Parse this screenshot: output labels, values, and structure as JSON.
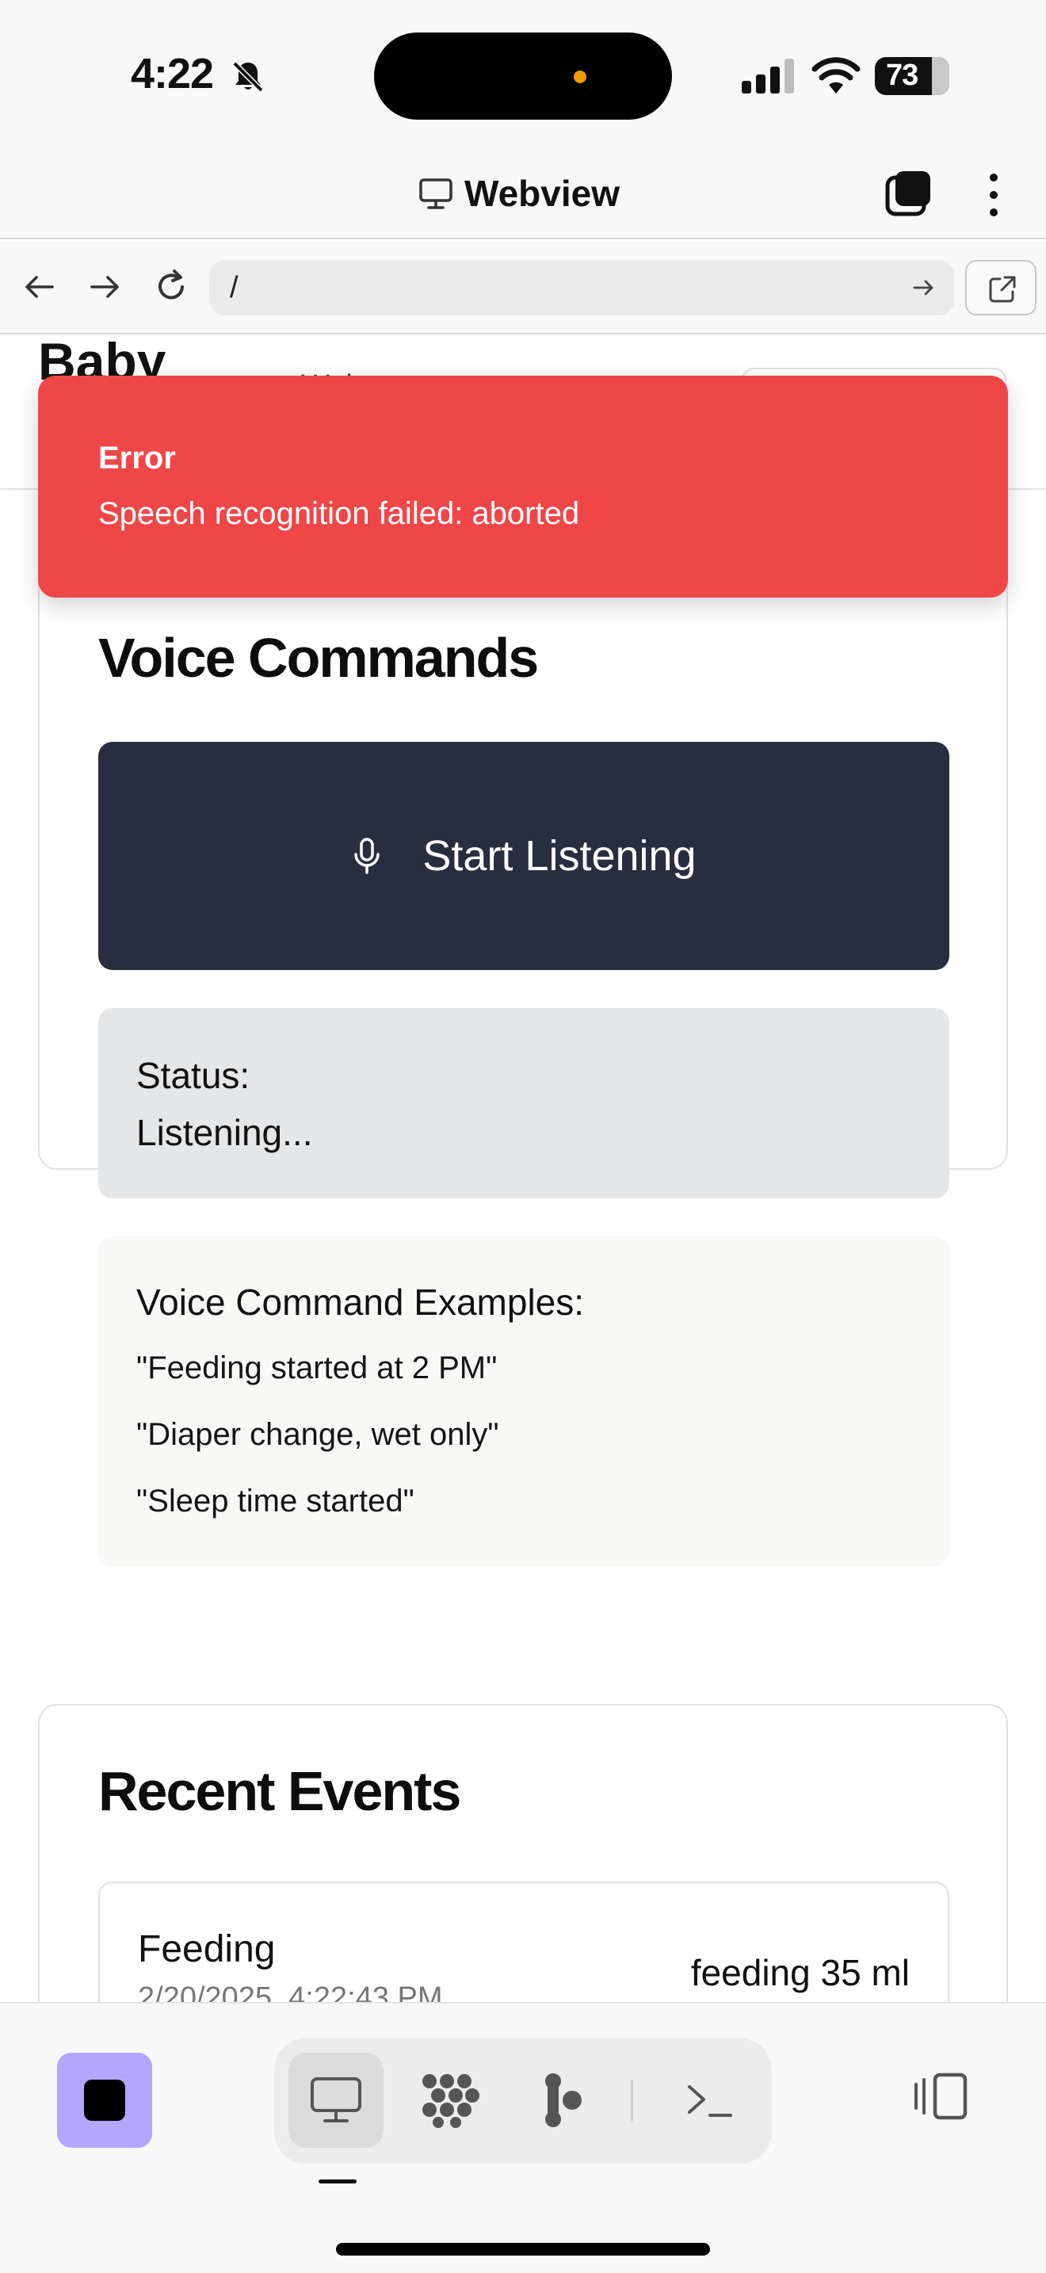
{
  "status_bar": {
    "time": "4:22",
    "battery": "73",
    "icons": [
      "bell-slash-icon",
      "signal-icon",
      "wifi-icon",
      "battery-icon"
    ]
  },
  "title_bar": {
    "title": "Webview",
    "icons": [
      "monitor-icon",
      "tabs-icon",
      "more-vertical-icon"
    ]
  },
  "browser": {
    "url": "/",
    "icons": [
      "back-arrow-icon",
      "forward-arrow-icon",
      "reload-icon",
      "go-arrow-icon",
      "external-link-icon"
    ]
  },
  "app_header": {
    "title": "Baby",
    "subtitle": "Web"
  },
  "toast": {
    "title": "Error",
    "message": "Speech recognition failed: aborted",
    "color": "#ef4648"
  },
  "voice_card": {
    "title": "Voice Commands",
    "button_label": "Start Listening",
    "button_color": "#272f3f",
    "status_label": "Status:",
    "status_value": "Listening...",
    "examples_title": "Voice Command Examples:",
    "examples": [
      "\"Feeding started at 2 PM\"",
      "\"Diaper change, wet only\"",
      "\"Sleep time started\""
    ]
  },
  "events_card": {
    "title": "Recent Events",
    "events": [
      {
        "type": "Feeding",
        "timestamp": "2/20/2025, 4:22:43 PM",
        "detail": "feeding 35 ml"
      }
    ]
  },
  "bottom_bar": {
    "accent": "#b4a6ff",
    "icons": [
      "stop-icon",
      "monitor-icon",
      "grid-dots-icon",
      "branch-icon",
      "terminal-icon",
      "panel-toggle-icon"
    ]
  }
}
